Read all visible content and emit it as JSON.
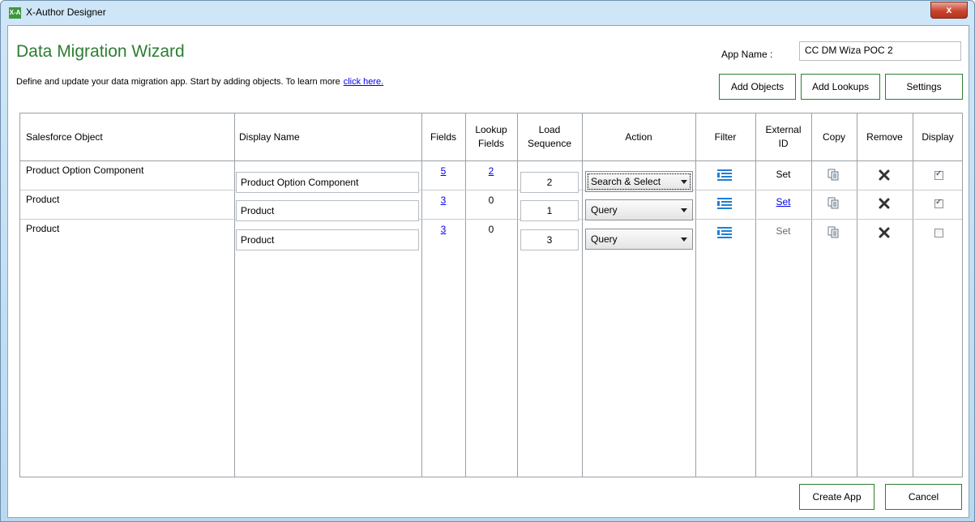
{
  "window": {
    "title": "X-Author Designer",
    "icon_text": "X-A",
    "close_label": "x"
  },
  "header": {
    "title": "Data Migration Wizard",
    "subtitle": "Define and update your data migration app. Start by adding objects. To learn more",
    "learn_more_link": "click here.",
    "app_name_label": "App Name :",
    "app_name_value": "CC DM Wiza POC 2"
  },
  "toolbar": {
    "add_objects": "Add Objects",
    "add_lookups": "Add Lookups",
    "settings": "Settings"
  },
  "table": {
    "columns": {
      "salesforce_object": "Salesforce Object",
      "display_name": "Display Name",
      "fields": "Fields",
      "lookup_fields_1": "Lookup",
      "lookup_fields_2": "Fields",
      "load_sequence_1": "Load",
      "load_sequence_2": "Sequence",
      "action": "Action",
      "filter": "Filter",
      "external_id_1": "External",
      "external_id_2": "ID",
      "copy": "Copy",
      "remove": "Remove",
      "display": "Display"
    },
    "rows": [
      {
        "object": "Product Option Component",
        "display_name": "Product Option Component",
        "fields": "5",
        "lookup_fields": "2",
        "load_sequence": "2",
        "action": "Search & Select",
        "external_id": "Set",
        "display": true
      },
      {
        "object": "Product",
        "display_name": "Product",
        "fields": "3",
        "lookup_fields": "0",
        "load_sequence": "1",
        "action": "Query",
        "external_id": "Set",
        "display": true
      },
      {
        "object": "Product",
        "display_name": "Product",
        "fields": "3",
        "lookup_fields": "0",
        "load_sequence": "3",
        "action": "Query",
        "external_id": "Set",
        "display": false
      }
    ]
  },
  "footer": {
    "create_app": "Create App",
    "cancel": "Cancel"
  },
  "colors": {
    "accent_green": "#2e7d32",
    "link_blue": "#0000ee",
    "filter_icon_blue": "#1e7fd4"
  }
}
